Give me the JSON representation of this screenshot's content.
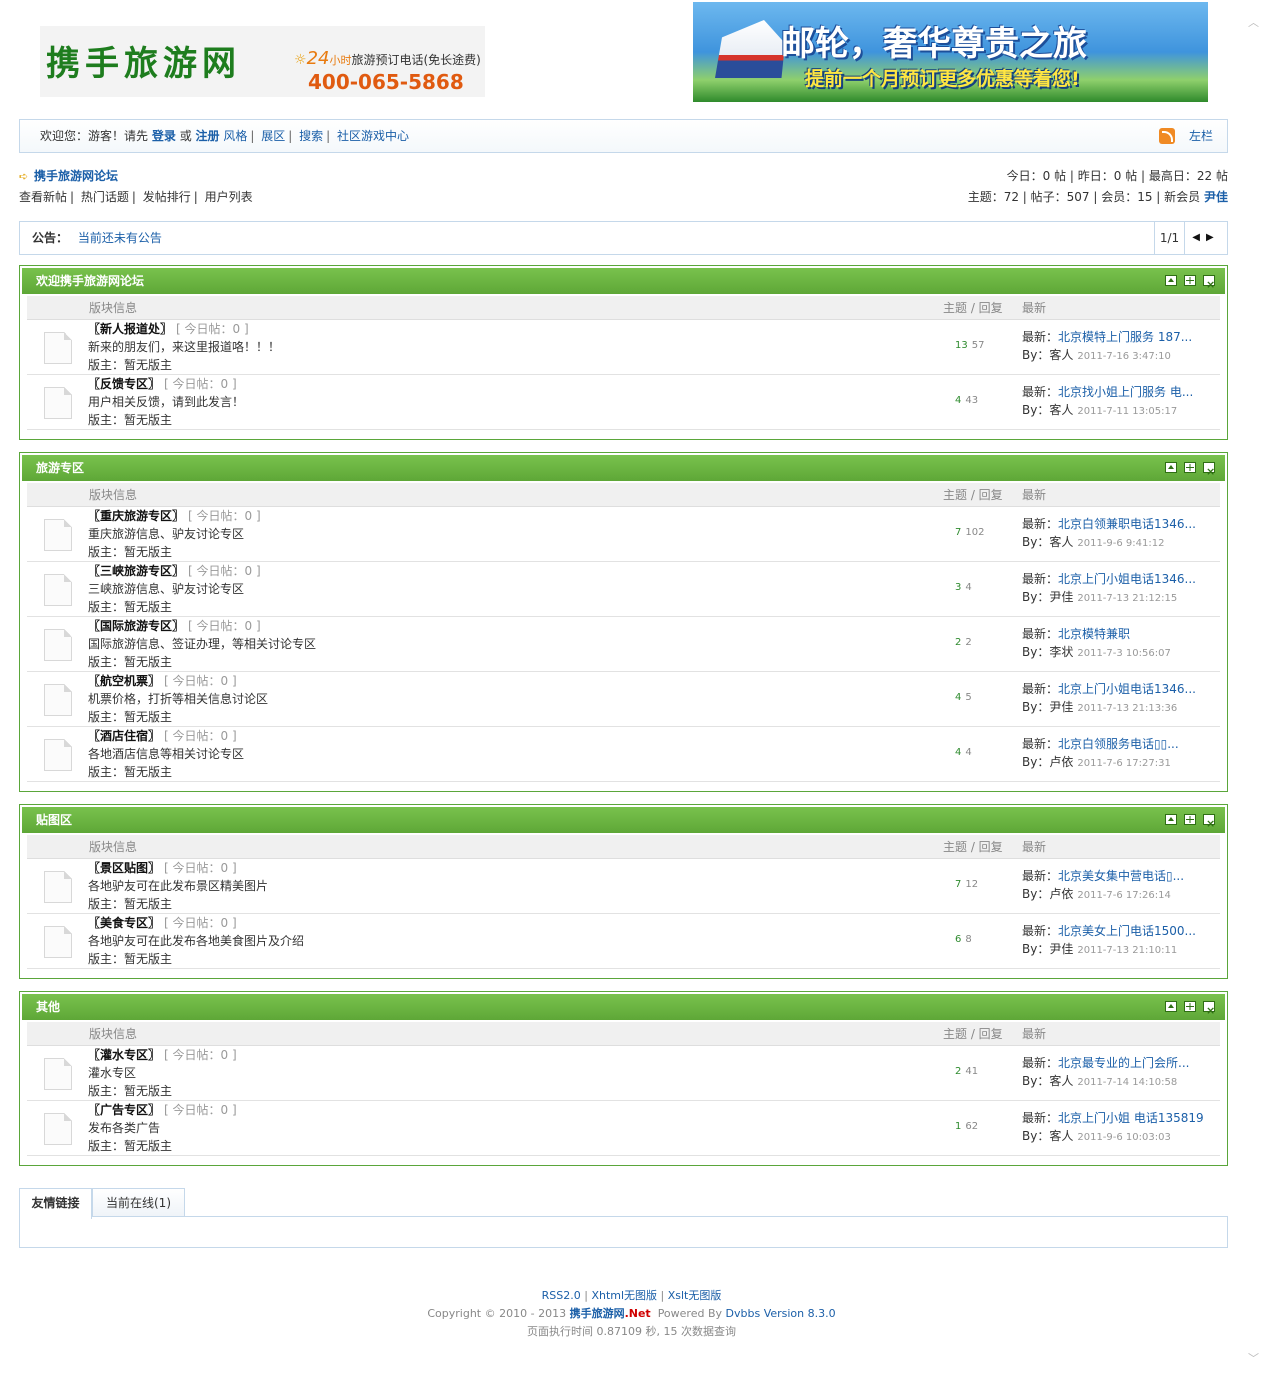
{
  "header": {
    "logo": "携手旅游网",
    "hotline_24": "24",
    "hotline_xiao": "小时",
    "hotline_label": "旅游预订电话(免长途费)",
    "hotline_number": "400-065-5868",
    "banner_title": "邮轮，奢华尊贵之旅",
    "banner_sub": "提前一个月预订更多优惠等着您!"
  },
  "usernav": {
    "welcome": "欢迎您：游客！请先",
    "login": "登录",
    "or": "或",
    "register": "注册",
    "style": "风格",
    "expand": "展区",
    "search": "搜索",
    "game_center": "社区游戏中心",
    "left_bar": "左栏"
  },
  "breadcrumb": {
    "forum_name": "携手旅游网论坛",
    "stats_today": "今日：0 帖 | 昨日：0 帖 | 最高日：22 帖",
    "stats_totals": "主题：72 | 帖子：507 | 会员：15 | 新会员",
    "newest_member": "尹佳"
  },
  "quicklinks": [
    "查看新帖",
    "热门话题",
    "发帖排行",
    "用户列表"
  ],
  "notice": {
    "label": "公告：",
    "text": "当前还未有公告",
    "page": "1/1"
  },
  "columns": {
    "board_info": "版块信息",
    "topics_replies": "主题 / 回复",
    "latest": "最新"
  },
  "latest_prefix": "最新：",
  "by_prefix": "By：",
  "categories": [
    {
      "title": "欢迎携手旅游网论坛",
      "boards": [
        {
          "name": "〖新人报道处〗",
          "today": "[ 今日帖：0 ]",
          "desc": "新来的朋友们，来这里报道咯！！！",
          "mod": "版主：暂无版主",
          "topics": "13",
          "replies": "57",
          "last_title": "北京模特上门服务 187...",
          "last_user": "客人",
          "last_time": "2011-7-16 3:47:10"
        },
        {
          "name": "〖反馈专区〗",
          "today": "[ 今日帖：0 ]",
          "desc": "用户相关反馈，请到此发言！",
          "mod": "版主：暂无版主",
          "topics": "4",
          "replies": "43",
          "last_title": "北京找小姐上门服务 电...",
          "last_user": "客人",
          "last_time": "2011-7-11 13:05:17"
        }
      ]
    },
    {
      "title": "旅游专区",
      "boards": [
        {
          "name": "〖重庆旅游专区〗",
          "today": "[ 今日帖：0 ]",
          "desc": "重庆旅游信息、驴友讨论专区",
          "mod": "版主：暂无版主",
          "topics": "7",
          "replies": "102",
          "last_title": "北京白领兼职电话1346...",
          "last_user": "客人",
          "last_time": "2011-9-6 9:41:12"
        },
        {
          "name": "〖三峡旅游专区〗",
          "today": "[ 今日帖：0 ]",
          "desc": "三峡旅游信息、驴友讨论专区",
          "mod": "版主：暂无版主",
          "topics": "3",
          "replies": "4",
          "last_title": "北京上门小姐电话1346...",
          "last_user": "尹佳",
          "last_time": "2011-7-13 21:12:15"
        },
        {
          "name": "〖国际旅游专区〗",
          "today": "[ 今日帖：0 ]",
          "desc": "国际旅游信息、签证办理，等相关讨论专区",
          "mod": "版主：暂无版主",
          "topics": "2",
          "replies": "2",
          "last_title": "北京模特兼职",
          "last_user": "李状",
          "last_time": "2011-7-3 10:56:07"
        },
        {
          "name": "〖航空机票〗",
          "today": "[ 今日帖：0 ]",
          "desc": "机票价格，打折等相关信息讨论区",
          "mod": "版主：暂无版主",
          "topics": "4",
          "replies": "5",
          "last_title": "北京上门小姐电话1346...",
          "last_user": "尹佳",
          "last_time": "2011-7-13 21:13:36"
        },
        {
          "name": "〖酒店住宿〗",
          "today": "[ 今日帖：0 ]",
          "desc": "各地酒店信息等相关讨论专区",
          "mod": "版主：暂无版主",
          "topics": "4",
          "replies": "4",
          "last_title": "北京白领服务电话▯▯...",
          "last_user": "卢依",
          "last_time": "2011-7-6 17:27:31"
        }
      ]
    },
    {
      "title": "贴图区",
      "boards": [
        {
          "name": "〖景区贴图〗",
          "today": "[ 今日帖：0 ]",
          "desc": "各地驴友可在此发布景区精美图片",
          "mod": "版主：暂无版主",
          "topics": "7",
          "replies": "12",
          "last_title": "北京美女集中营电话▯...",
          "last_user": "卢依",
          "last_time": "2011-7-6 17:26:14"
        },
        {
          "name": "〖美食专区〗",
          "today": "[ 今日帖：0 ]",
          "desc": "各地驴友可在此发布各地美食图片及介绍",
          "mod": "版主：暂无版主",
          "topics": "6",
          "replies": "8",
          "last_title": "北京美女上门电话1500...",
          "last_user": "尹佳",
          "last_time": "2011-7-13 21:10:11"
        }
      ]
    },
    {
      "title": "其他",
      "boards": [
        {
          "name": "〖灌水专区〗",
          "today": "[ 今日帖：0 ]",
          "desc": "灌水专区",
          "mod": "版主：暂无版主",
          "topics": "2",
          "replies": "41",
          "last_title": "北京最专业的上门会所...",
          "last_user": "客人",
          "last_time": "2011-7-14 14:10:58"
        },
        {
          "name": "〖广告专区〗",
          "today": "[ 今日帖：0 ]",
          "desc": "发布各类广告",
          "mod": "版主：暂无版主",
          "topics": "1",
          "replies": "62",
          "last_title": "北京上门小姐 电话135819",
          "last_user": "客人",
          "last_time": "2011-9-6 10:03:03"
        }
      ]
    }
  ],
  "bottom_tabs": {
    "links": "友情链接",
    "online": "当前在线(1)"
  },
  "footer": {
    "rss": "RSS2.0",
    "xhtml": "Xhtml无图版",
    "xslt": "Xslt无图版",
    "copyright": "Copyright © 2010 - 2013",
    "brand": "携手旅游网",
    "brand_net": ".Net",
    "powered_by": "Powered By",
    "powered_link": "Dvbbs Version 8.3.0",
    "exec_time": "页面执行时间 0.87109 秒, 15 次数据查询"
  },
  "colors": {
    "accent_green": "#5ea737",
    "link_blue": "#1b5fa8",
    "border_blue": "#c5d8ea"
  }
}
